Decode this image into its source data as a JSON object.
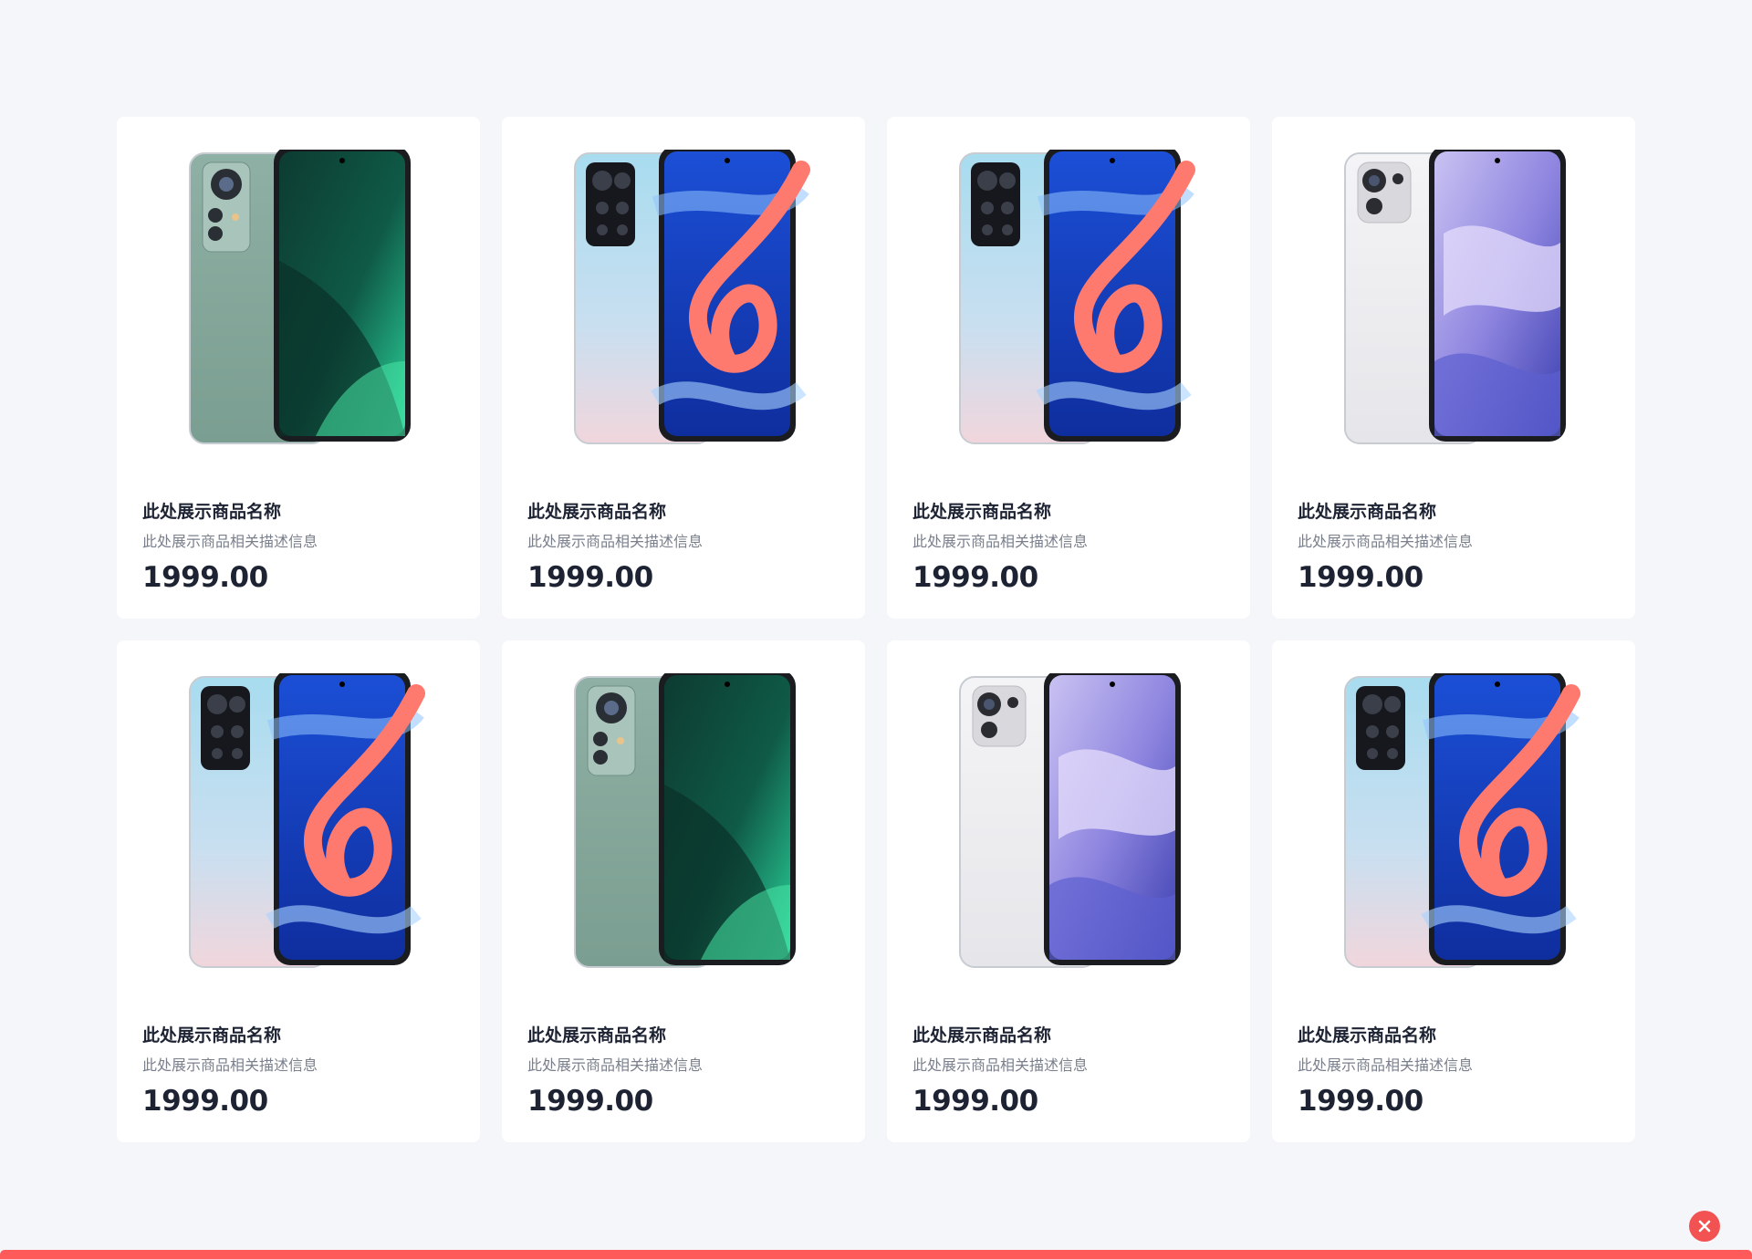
{
  "products": [
    {
      "name": "此处展示商品名称",
      "description": "此处展示商品相关描述信息",
      "price": "1999.00",
      "variant": "green"
    },
    {
      "name": "此处展示商品名称",
      "description": "此处展示商品相关描述信息",
      "price": "1999.00",
      "variant": "redmi"
    },
    {
      "name": "此处展示商品名称",
      "description": "此处展示商品相关描述信息",
      "price": "1999.00",
      "variant": "redmi"
    },
    {
      "name": "此处展示商品名称",
      "description": "此处展示商品相关描述信息",
      "price": "1999.00",
      "variant": "white"
    },
    {
      "name": "此处展示商品名称",
      "description": "此处展示商品相关描述信息",
      "price": "1999.00",
      "variant": "redmi"
    },
    {
      "name": "此处展示商品名称",
      "description": "此处展示商品相关描述信息",
      "price": "1999.00",
      "variant": "green"
    },
    {
      "name": "此处展示商品名称",
      "description": "此处展示商品相关描述信息",
      "price": "1999.00",
      "variant": "white"
    },
    {
      "name": "此处展示商品名称",
      "description": "此处展示商品相关描述信息",
      "price": "1999.00",
      "variant": "redmi"
    }
  ],
  "close_icon": "close-icon",
  "colors": {
    "background": "#f5f6f9",
    "card": "#ffffff",
    "accent": "#ff5a5a",
    "text_primary": "#1d2333",
    "text_secondary": "#7a7f8c"
  }
}
